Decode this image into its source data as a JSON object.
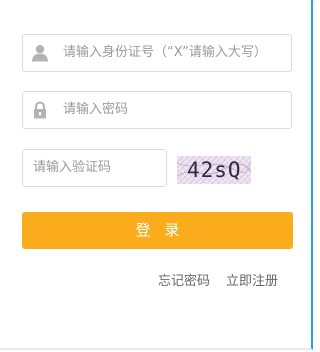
{
  "form": {
    "id_field": {
      "placeholder": "请输入身份证号（“X”请输入大写）",
      "icon": "user-icon"
    },
    "password_field": {
      "placeholder": "请输入密码",
      "icon": "lock-icon"
    },
    "captcha_field": {
      "placeholder": "请输入验证码"
    },
    "captcha_image": {
      "code": "42sQ"
    },
    "login_button_label": "登录"
  },
  "links": {
    "forgot_password": "忘记密码",
    "register": "立即注册"
  },
  "colors": {
    "accent": "#fbac1d",
    "border_blue": "#2aa0e6",
    "placeholder": "#9a9a9a",
    "icon": "#b3b3b3"
  }
}
